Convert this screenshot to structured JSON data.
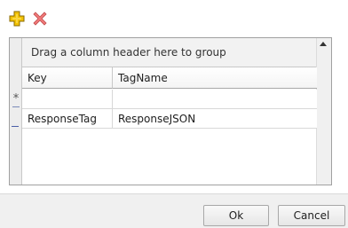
{
  "toolbar": {
    "add_icon": "plus-icon",
    "remove_icon": "x-icon",
    "add_color": "#f2c200",
    "remove_color": "#e05a5a"
  },
  "grid": {
    "group_panel_text": "Drag a column header here to group",
    "columns": [
      "Key",
      "TagName"
    ],
    "new_row_marker": "*",
    "rows": [
      {
        "key": "ResponseTag",
        "tagname": "ResponseJSON"
      }
    ]
  },
  "dialog": {
    "ok_label": "Ok",
    "cancel_label": "Cancel"
  }
}
